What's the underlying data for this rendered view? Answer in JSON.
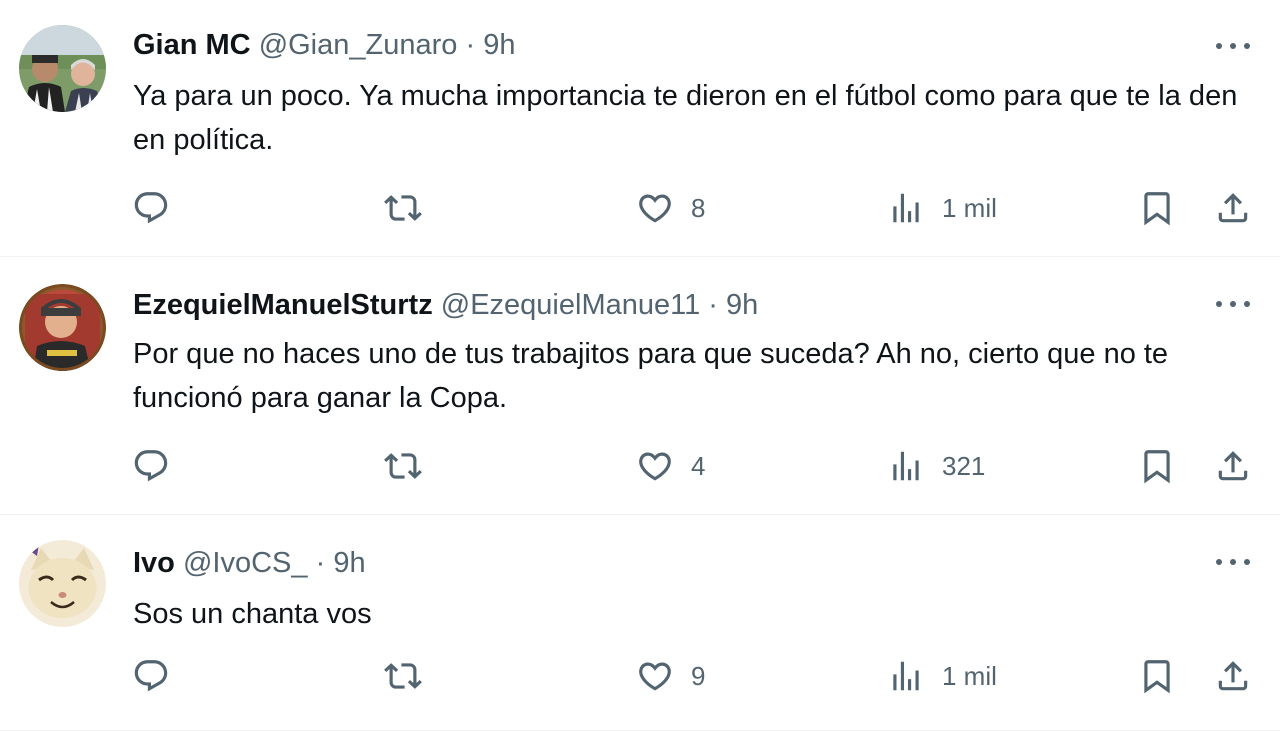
{
  "tweets": [
    {
      "name": "Gian MC",
      "handle": "@Gian_Zunaro",
      "separator": "·",
      "time": "9h",
      "text": "Ya para un poco. Ya mucha importancia te dieron en el fútbol como para que te la den en política.",
      "likes": "8",
      "views": "1 mil"
    },
    {
      "name": "EzequielManuelSturtz",
      "handle": "@EzequielManue11",
      "separator": "·",
      "time": "9h",
      "text": "Por que no haces uno de tus trabajitos para que suceda? Ah no, cierto que no te funcionó para ganar la Copa.",
      "likes": "4",
      "views": "321"
    },
    {
      "name": "Ivo",
      "handle": "@IvoCS_",
      "separator": "·",
      "time": "9h",
      "text": "Sos un chanta vos",
      "likes": "9",
      "views": "1 mil"
    }
  ],
  "icons": {
    "reply": "reply-icon",
    "retweet": "retweet-icon",
    "like": "heart-icon",
    "views": "views-icon",
    "bookmark": "bookmark-icon",
    "share": "share-icon",
    "more": "more-icon"
  },
  "colors": {
    "text": "#0f1419",
    "secondary": "#536471",
    "divider": "#eff3f4"
  }
}
